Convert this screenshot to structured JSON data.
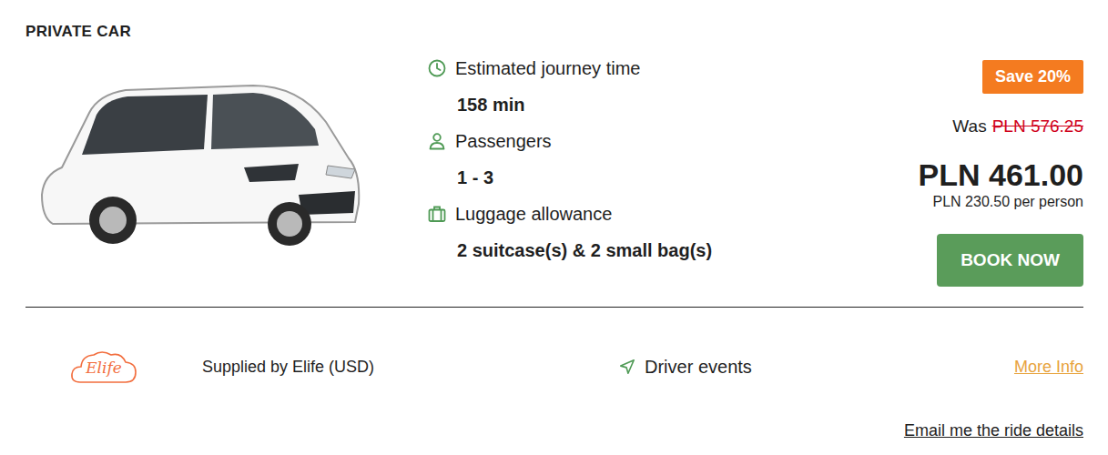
{
  "title": "PRIVATE CAR",
  "details": [
    {
      "kind": "clock",
      "label": "Estimated journey time",
      "value": "158 min"
    },
    {
      "kind": "person",
      "label": "Passengers",
      "value": "1 - 3"
    },
    {
      "kind": "luggage",
      "label": "Luggage allowance",
      "value": "2 suitcase(s) & 2 small bag(s)"
    }
  ],
  "price": {
    "badge": "Save 20%",
    "was_label": "Was",
    "was_price": "PLN 576.25",
    "price": "PLN 461.00",
    "per_person": "PLN 230.50 per person"
  },
  "book_button": "BOOK NOW",
  "supplier": {
    "logo": "Elife",
    "text": "Supplied by Elife (USD)"
  },
  "driver_events": "Driver events",
  "more_info": "More Info",
  "email_link": "Email me the ride details"
}
